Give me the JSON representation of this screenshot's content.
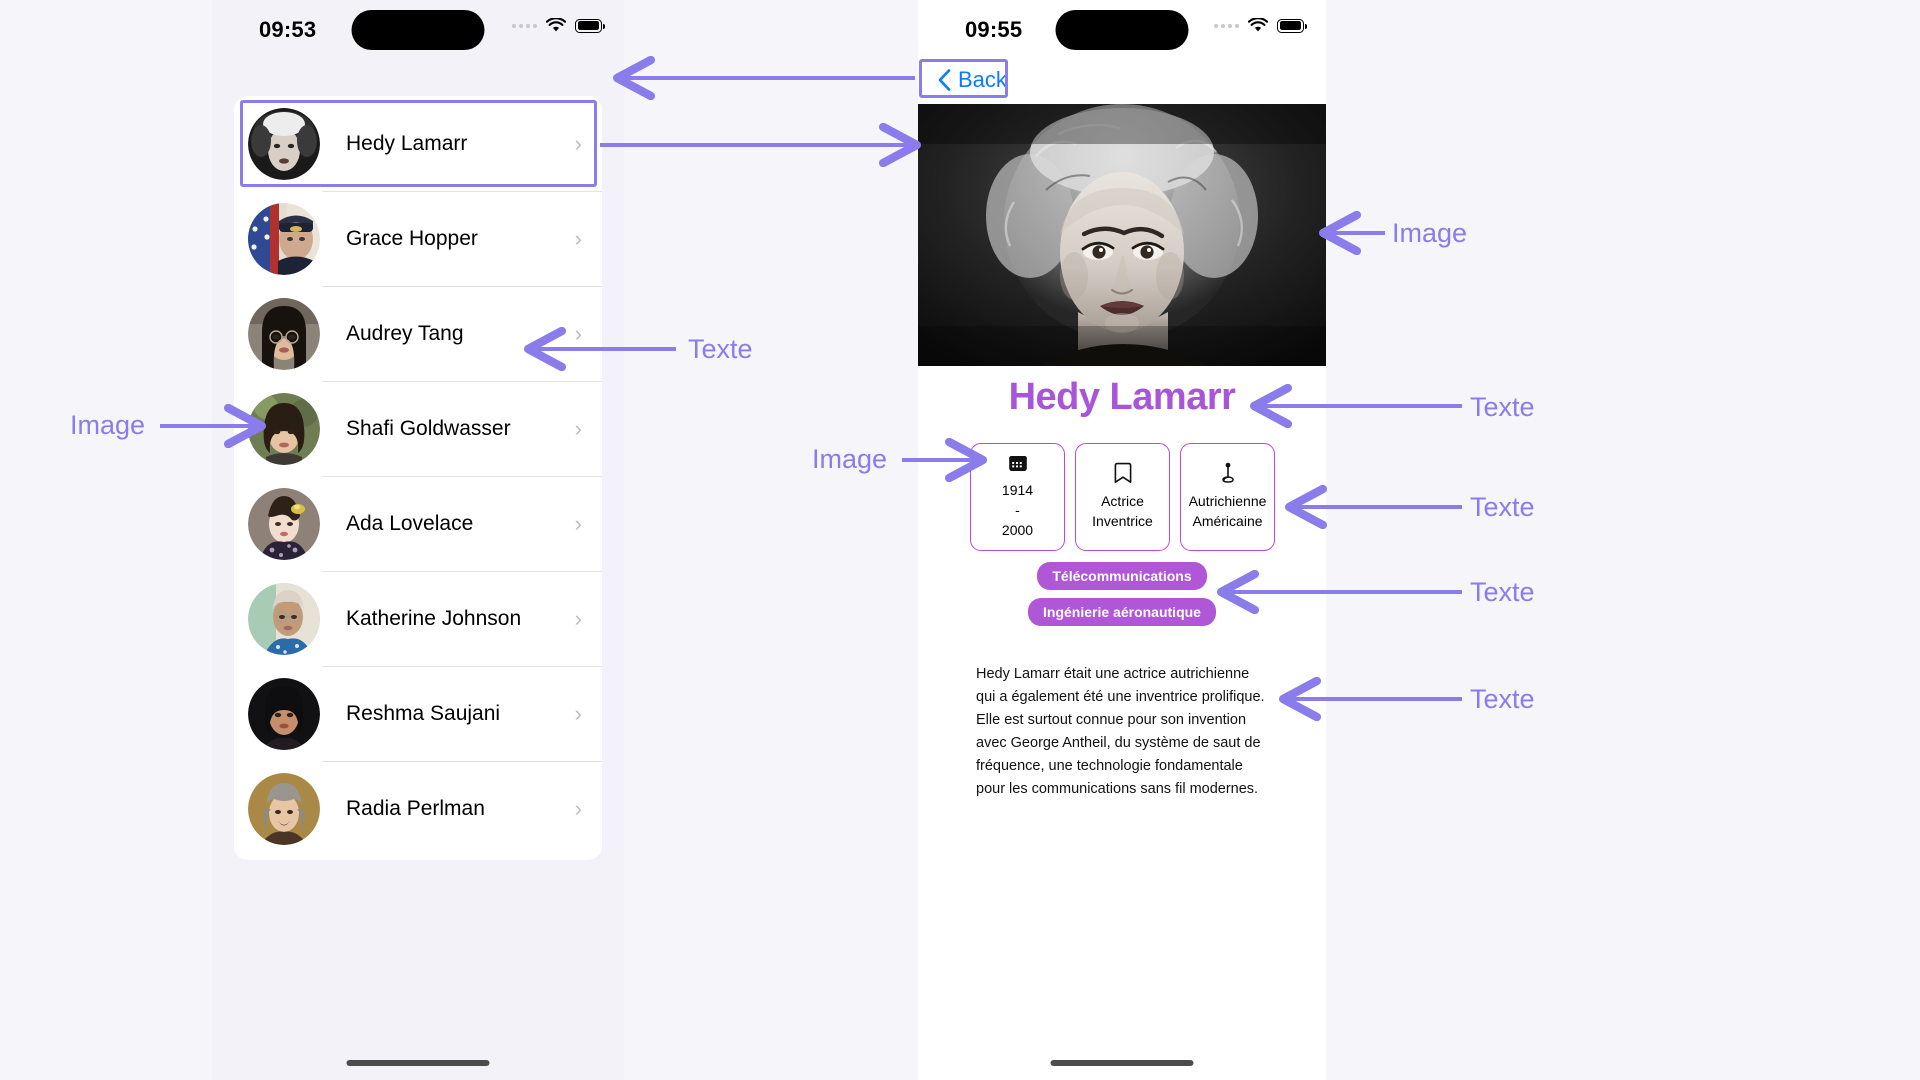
{
  "background_color": "#f6f5fa",
  "accent_annotation_color": "#8a7cea",
  "list_screen": {
    "status": {
      "time": "09:53",
      "wifi_icon": "wifi-icon",
      "battery_icon": "battery-icon",
      "signal_icon": "signal-dots-icon"
    },
    "people": [
      {
        "name": "Hedy Lamarr",
        "chevron": "›"
      },
      {
        "name": "Grace Hopper",
        "chevron": "›"
      },
      {
        "name": "Audrey Tang",
        "chevron": "›"
      },
      {
        "name": "Shafi Goldwasser",
        "chevron": "›"
      },
      {
        "name": "Ada Lovelace",
        "chevron": "›"
      },
      {
        "name": "Katherine Johnson",
        "chevron": "›"
      },
      {
        "name": "Reshma Saujani",
        "chevron": "›"
      },
      {
        "name": "Radia Perlman",
        "chevron": "›"
      }
    ]
  },
  "detail_screen": {
    "status": {
      "time": "09:55",
      "wifi_icon": "wifi-icon",
      "battery_icon": "battery-icon",
      "signal_icon": "signal-dots-icon"
    },
    "back_label": "Back",
    "back_icon": "chevron-left-icon",
    "back_color": "#0a7cff",
    "hero_image_alt": "hedy-lamarr-portrait",
    "title": "Hedy Lamarr",
    "title_color": "#a855d8",
    "info_cards": [
      {
        "icon": "calendar-icon",
        "lines": [
          "1914",
          "-",
          "2000"
        ]
      },
      {
        "icon": "bookmark-icon",
        "lines": [
          "Actrice",
          "Inventrice"
        ]
      },
      {
        "icon": "location-pin-icon",
        "lines": [
          "Autrichienne",
          "Américaine"
        ]
      }
    ],
    "tags": [
      "Télécommunications",
      "Ingénierie aéronautique"
    ],
    "tag_color": "#b057d8",
    "biography": "Hedy Lamarr était une actrice autrichienne qui a également été une inventrice prolifique. Elle est surtout connue pour son invention avec George Antheil, du système de saut de fréquence, une technologie fondamentale pour les communications sans fil modernes."
  },
  "annotations": [
    {
      "id": "image-left",
      "label": "Image"
    },
    {
      "id": "texte-left",
      "label": "Texte"
    },
    {
      "id": "image-hero",
      "label": "Image"
    },
    {
      "id": "texte-title",
      "label": "Texte"
    },
    {
      "id": "image-cards",
      "label": "Image"
    },
    {
      "id": "texte-cards",
      "label": "Texte"
    },
    {
      "id": "texte-tags",
      "label": "Texte"
    },
    {
      "id": "texte-bio",
      "label": "Texte"
    }
  ]
}
